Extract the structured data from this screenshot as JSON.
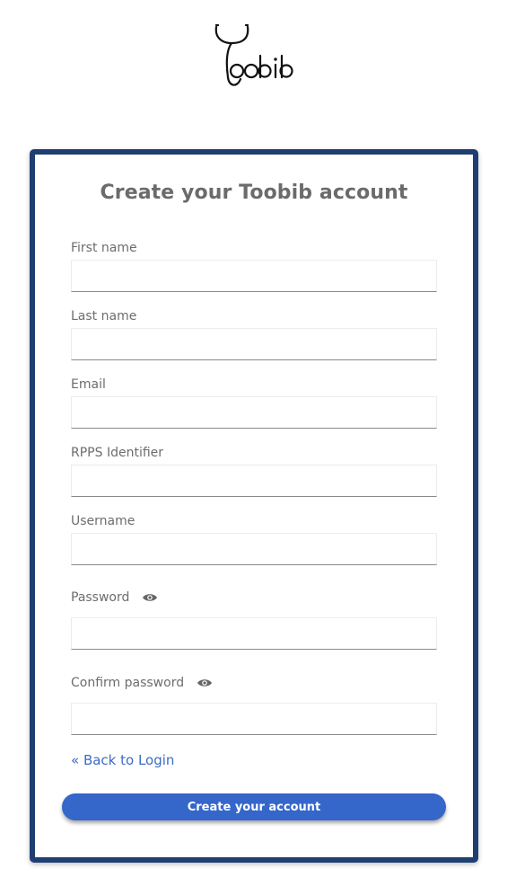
{
  "brand": {
    "logo_text": "Toobib"
  },
  "form": {
    "title": "Create your Toobib account",
    "fields": [
      {
        "label": "First name",
        "value": ""
      },
      {
        "label": "Last name",
        "value": ""
      },
      {
        "label": "Email",
        "value": ""
      },
      {
        "label": "RPPS Identifier",
        "value": ""
      },
      {
        "label": "Username",
        "value": ""
      },
      {
        "label": "Password",
        "value": "",
        "icon": "eye-icon"
      },
      {
        "label": "Confirm password",
        "value": "",
        "icon": "eye-icon"
      }
    ],
    "back_link": "« Back to Login",
    "submit_label": "Create your account"
  },
  "colors": {
    "card_border": "#1f3f73",
    "button": "#3566c9",
    "link": "#3d6bc4",
    "title": "#6b6b6b"
  }
}
